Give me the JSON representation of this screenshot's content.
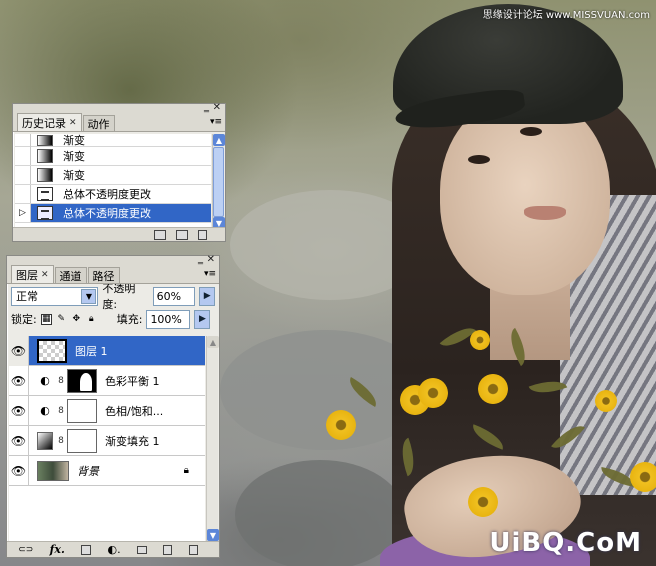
{
  "watermarks": {
    "top": "思缘设计论坛 www.MISSVUAN.com",
    "bottom": "UiBQ.CoM"
  },
  "history_panel": {
    "tabs": [
      {
        "label": "历史记录",
        "active": true,
        "closable": true
      },
      {
        "label": "动作",
        "active": false,
        "closable": false
      }
    ],
    "items": [
      {
        "label": "渐变",
        "icon": "gradient-icon",
        "selected": false
      },
      {
        "label": "渐变",
        "icon": "gradient-icon",
        "selected": false
      },
      {
        "label": "渐变",
        "icon": "gradient-icon",
        "selected": false
      },
      {
        "label": "总体不透明度更改",
        "icon": "document-icon",
        "selected": false
      },
      {
        "label": "总体不透明度更改",
        "icon": "document-icon",
        "selected": true
      }
    ]
  },
  "layers_panel": {
    "tabs": [
      {
        "label": "图层",
        "active": true,
        "closable": true
      },
      {
        "label": "通道",
        "active": false,
        "closable": false
      },
      {
        "label": "路径",
        "active": false,
        "closable": false
      }
    ],
    "blend_mode": "正常",
    "opacity_label": "不透明度:",
    "opacity_value": "60%",
    "lock_label": "锁定:",
    "fill_label": "填充:",
    "fill_value": "100%",
    "layers": [
      {
        "name": "图层 1",
        "thumb": "transparent",
        "adjustment": false,
        "selected": true,
        "visible": true
      },
      {
        "name": "色彩平衡 1",
        "thumb": "mask",
        "adjustment": true,
        "selected": false,
        "visible": true
      },
      {
        "name": "色相/饱和...",
        "thumb": "white",
        "adjustment": true,
        "selected": false,
        "visible": true
      },
      {
        "name": "渐变填充 1",
        "thumb": "white",
        "adjustment": "gradient",
        "selected": false,
        "visible": true
      },
      {
        "name": "背景",
        "thumb": "photo",
        "adjustment": false,
        "selected": false,
        "visible": true,
        "locked": true
      }
    ],
    "footer_icons": [
      "link-icon",
      "fx-icon",
      "mask-icon",
      "adjustment-icon",
      "group-icon",
      "new-layer-icon",
      "trash-icon"
    ]
  },
  "colors": {
    "selection": "#3166c6",
    "panel_bg": "#ecebe6"
  }
}
